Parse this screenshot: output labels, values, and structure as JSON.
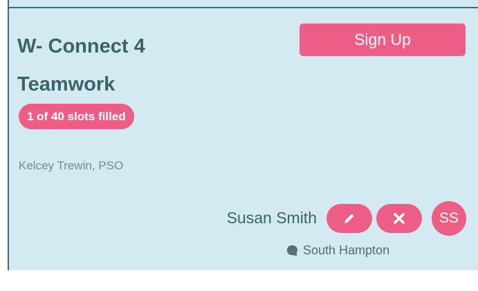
{
  "event": {
    "title_line1": "W- Connect 4",
    "title_line2": "Teamwork",
    "slots_text": "1 of 40 slots filled",
    "organizer": "Kelcey Trewin, PSO"
  },
  "actions": {
    "signup_label": "Sign Up"
  },
  "participant": {
    "name": "Susan Smith",
    "initials": "SS",
    "location": "South Hampton",
    "edit_icon": "pencil-icon",
    "remove_icon": "x-icon",
    "location_icon": "speech-bubble-icon"
  },
  "colors": {
    "accent": "#ec5e86",
    "card_bg": "#d3eaf2",
    "heading": "#3c6468",
    "border": "#3f6b72"
  }
}
